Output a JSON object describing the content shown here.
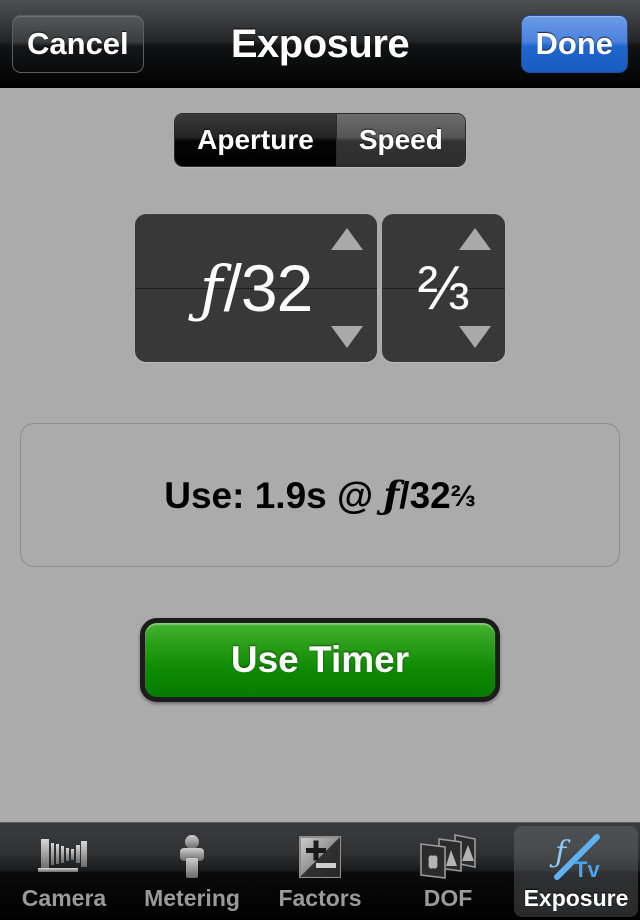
{
  "navbar": {
    "cancel_label": "Cancel",
    "title": "Exposure",
    "done_label": "Done",
    "done_color": "#2a6fd4"
  },
  "segmented": {
    "options": [
      {
        "label": "Aperture",
        "selected": true
      },
      {
        "label": "Speed",
        "selected": false
      }
    ]
  },
  "steppers": {
    "aperture": {
      "value": "ƒ/32",
      "f_glyph": "ƒ",
      "number": "/32",
      "up_icon": "triangle-up-icon",
      "down_icon": "triangle-down-icon"
    },
    "fraction": {
      "value": "⅔",
      "up_icon": "triangle-up-icon",
      "down_icon": "triangle-down-icon"
    }
  },
  "result": {
    "prefix": "Use: 1.9s @ ",
    "f_glyph": "ƒ",
    "aperture": "/32",
    "fraction": "⅔",
    "full_text": "Use: 1.9s @ ƒ/32⅔"
  },
  "timer": {
    "label": "Use Timer",
    "color": "#0f8a02"
  },
  "tabbar": {
    "tabs": [
      {
        "label": "Camera",
        "icon": "view-camera-icon",
        "active": false
      },
      {
        "label": "Metering",
        "icon": "light-meter-icon",
        "active": false
      },
      {
        "label": "Factors",
        "icon": "plus-minus-icon",
        "active": false
      },
      {
        "label": "DOF",
        "icon": "depth-planes-icon",
        "active": false
      },
      {
        "label": "Exposure",
        "icon": "f-tv-icon",
        "active": true
      }
    ],
    "accent": "#4aa3ee"
  }
}
